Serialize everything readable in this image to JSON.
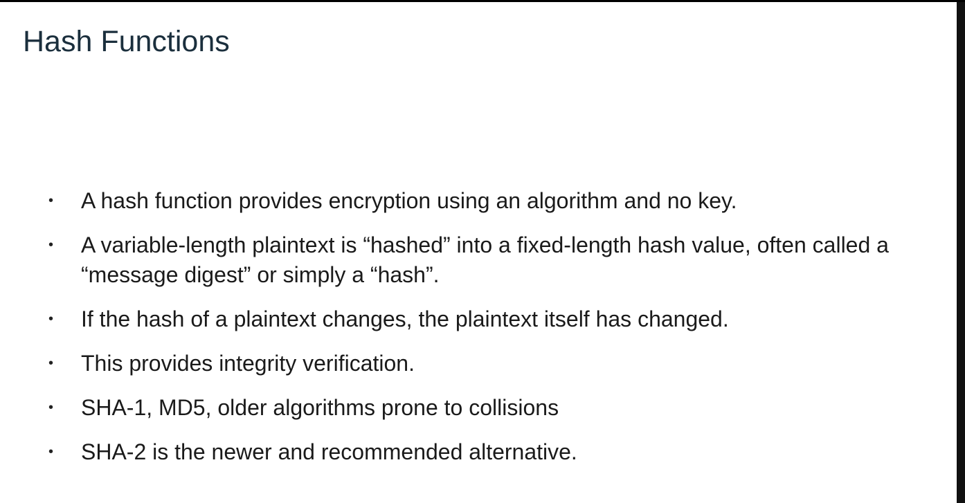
{
  "slide": {
    "title": "Hash Functions",
    "bullets": [
      {
        "marker": "•",
        "text": "A hash function provides encryption using an algorithm and no key."
      },
      {
        "marker": "•",
        "text": "A variable-length plaintext is “hashed” into a fixed-length hash value, often called a “message digest” or simply a “hash”."
      },
      {
        "marker": "•",
        "text": "If the hash of a plaintext changes, the plaintext itself has changed."
      },
      {
        "marker": "•",
        "text": "This provides integrity verification."
      },
      {
        "marker": "•",
        "text": "SHA-1, MD5, older algorithms prone to collisions"
      },
      {
        "marker": "•",
        "text": "SHA-2 is the newer and recommended alternative."
      }
    ]
  },
  "colors": {
    "title": "#1b2f3d",
    "body_text": "#1a1a1a",
    "background": "#ffffff",
    "frame": "#000000"
  }
}
